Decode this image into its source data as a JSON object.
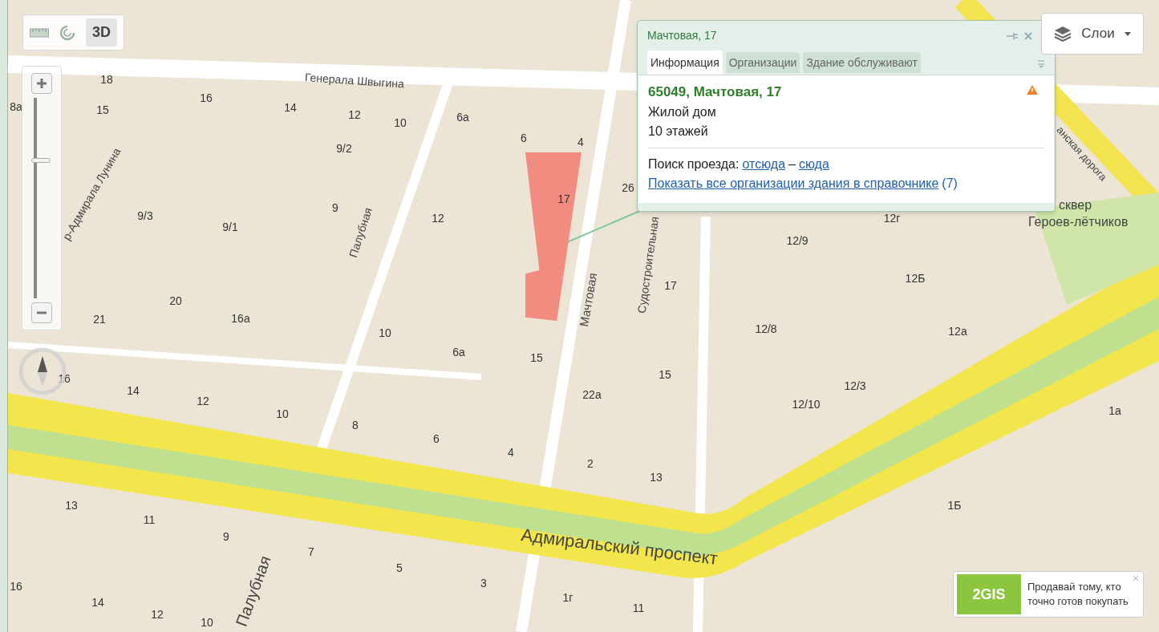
{
  "map": {
    "streets": [
      {
        "text": "Генерала Швыгина"
      },
      {
        "text": "р-Адмирала Лунина"
      },
      {
        "text": "Палубная"
      },
      {
        "text": "Мачтовая"
      },
      {
        "text": "Судостроительная"
      },
      {
        "text": "Адмиральский проспект"
      },
      {
        "text": "Палубная"
      },
      {
        "text": "анская дорога"
      },
      {
        "text": "сквер"
      },
      {
        "text": "Героев-лётчиков"
      }
    ],
    "buildings": [
      {
        "number": "18",
        "selected": false
      },
      {
        "number": "16",
        "selected": false
      },
      {
        "number": "14",
        "selected": false
      },
      {
        "number": "12",
        "selected": false
      },
      {
        "number": "10",
        "selected": false
      },
      {
        "number": "6а",
        "selected": false
      },
      {
        "number": "6",
        "selected": false
      },
      {
        "number": "4",
        "selected": false
      },
      {
        "number": "15",
        "selected": false
      },
      {
        "number": "8а",
        "selected": false
      },
      {
        "number": "9/2",
        "selected": false
      },
      {
        "number": "9/3",
        "selected": false
      },
      {
        "number": "9/1",
        "selected": false
      },
      {
        "number": "9",
        "selected": false
      },
      {
        "number": "12",
        "selected": false
      },
      {
        "number": "17",
        "selected": true
      },
      {
        "number": "26",
        "selected": false
      },
      {
        "number": "20",
        "selected": false
      },
      {
        "number": "21",
        "selected": false
      },
      {
        "number": "16а",
        "selected": false
      },
      {
        "number": "10",
        "selected": false
      },
      {
        "number": "6а",
        "selected": false
      },
      {
        "number": "15",
        "selected": false
      },
      {
        "number": "17",
        "selected": false
      },
      {
        "number": "15",
        "selected": false
      },
      {
        "number": "22а",
        "selected": false
      },
      {
        "number": "16",
        "selected": false
      },
      {
        "number": "14",
        "selected": false
      },
      {
        "number": "12",
        "selected": false
      },
      {
        "number": "10",
        "selected": false
      },
      {
        "number": "8",
        "selected": false
      },
      {
        "number": "6",
        "selected": false
      },
      {
        "number": "4",
        "selected": false
      },
      {
        "number": "2",
        "selected": false
      },
      {
        "number": "13",
        "selected": false
      },
      {
        "number": "13",
        "selected": false
      },
      {
        "number": "11",
        "selected": false
      },
      {
        "number": "9",
        "selected": false
      },
      {
        "number": "7",
        "selected": false
      },
      {
        "number": "5",
        "selected": false
      },
      {
        "number": "3",
        "selected": false
      },
      {
        "number": "1г",
        "selected": false
      },
      {
        "number": "11",
        "selected": false
      },
      {
        "number": "16",
        "selected": false
      },
      {
        "number": "14",
        "selected": false
      },
      {
        "number": "12",
        "selected": false
      },
      {
        "number": "10",
        "selected": false
      },
      {
        "number": "12г",
        "selected": false
      },
      {
        "number": "12/9",
        "selected": false
      },
      {
        "number": "12Б",
        "selected": false
      },
      {
        "number": "12/8",
        "selected": false
      },
      {
        "number": "12а",
        "selected": false
      },
      {
        "number": "12/3",
        "selected": false
      },
      {
        "number": "12/10",
        "selected": false
      },
      {
        "number": "1а",
        "selected": false
      },
      {
        "number": "1Б",
        "selected": false
      }
    ]
  },
  "toolbar": {
    "view_mode": "3D",
    "view_3d_on": true
  },
  "zoom": {
    "level": 0.7
  },
  "popup": {
    "title": "Мачтовая, 17",
    "tabs": [
      {
        "label": "Информация",
        "selected": true
      },
      {
        "label": "Организации",
        "selected": false
      },
      {
        "label": "Здание обслуживают",
        "selected": false
      }
    ],
    "address": "65049, Мачтовая, 17",
    "type": "Жилой дом",
    "floors": "10 этажей",
    "route_label": "Поиск проезда:",
    "route_from": "отсюда",
    "route_sep": "–",
    "route_to": "сюда",
    "all_orgs_link": "Показать все организации здания в справочнике",
    "all_orgs_count": "(7)"
  },
  "layers": {
    "label": "Слои"
  },
  "ad": {
    "logo": "2GIS",
    "text": "Продавай тому, кто точно готов покупать"
  }
}
